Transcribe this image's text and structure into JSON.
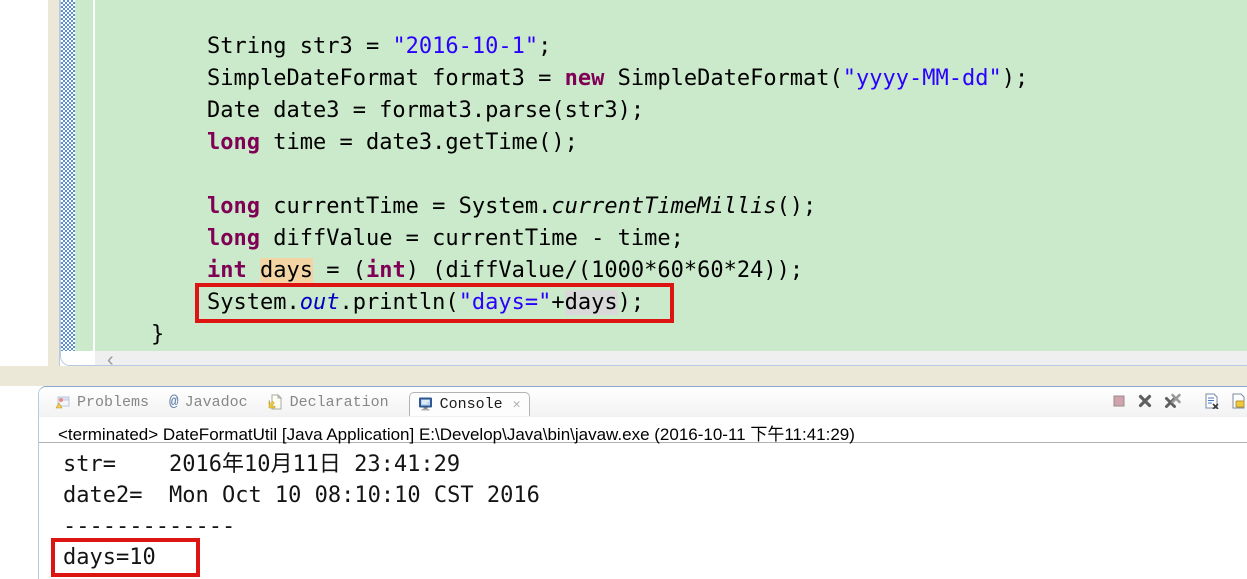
{
  "editor": {
    "lines": [
      {
        "indent": 2,
        "tokens": [
          {
            "t": "String str3 = ",
            "c": "p"
          },
          {
            "t": "\"2016-10-1\"",
            "c": "s"
          },
          {
            "t": ";",
            "c": "p"
          }
        ]
      },
      {
        "indent": 2,
        "tokens": [
          {
            "t": "SimpleDateFormat format3 = ",
            "c": "p"
          },
          {
            "t": "new",
            "c": "k"
          },
          {
            "t": " SimpleDateFormat(",
            "c": "p"
          },
          {
            "t": "\"yyyy-MM-dd\"",
            "c": "s"
          },
          {
            "t": ");",
            "c": "p"
          }
        ]
      },
      {
        "indent": 2,
        "tokens": [
          {
            "t": "Date date3 = format3.parse(str3);",
            "c": "p"
          }
        ]
      },
      {
        "indent": 2,
        "tokens": [
          {
            "t": "long",
            "c": "k"
          },
          {
            "t": " time = date3.getTime();",
            "c": "p"
          }
        ]
      },
      {
        "indent": 2,
        "tokens": []
      },
      {
        "indent": 2,
        "tokens": [
          {
            "t": "long",
            "c": "k"
          },
          {
            "t": " currentTime = System.",
            "c": "p"
          },
          {
            "t": "currentTimeMillis",
            "c": "sm"
          },
          {
            "t": "();",
            "c": "p"
          }
        ]
      },
      {
        "indent": 2,
        "tokens": [
          {
            "t": "long",
            "c": "k"
          },
          {
            "t": " diffValue = currentTime - time;",
            "c": "p"
          }
        ]
      },
      {
        "indent": 2,
        "tokens": [
          {
            "t": "int",
            "c": "k"
          },
          {
            "t": " ",
            "c": "p"
          },
          {
            "t": "days",
            "c": "w"
          },
          {
            "t": " = (",
            "c": "p"
          },
          {
            "t": "int",
            "c": "k"
          },
          {
            "t": ") (diffValue/(1000*60*60*24));",
            "c": "p"
          }
        ]
      },
      {
        "indent": 2,
        "boxed": true,
        "tokens": [
          {
            "t": "System.",
            "c": "p"
          },
          {
            "t": "out",
            "c": "sf"
          },
          {
            "t": ".println(",
            "c": "p"
          },
          {
            "t": "\"days=\"",
            "c": "s"
          },
          {
            "t": "+",
            "c": "p"
          },
          {
            "t": "days",
            "c": "r"
          },
          {
            "t": ");",
            "c": "p"
          }
        ]
      },
      {
        "indent": 1,
        "tokens": [
          {
            "t": "}",
            "c": "p"
          }
        ]
      }
    ],
    "scroll_left_glyph": "‹"
  },
  "console": {
    "tabs": [
      {
        "label": "Problems",
        "icon": "problems-icon",
        "active": false
      },
      {
        "label": "Javadoc",
        "icon": "javadoc-icon",
        "active": false
      },
      {
        "label": "Declaration",
        "icon": "declaration-icon",
        "active": false
      },
      {
        "label": "Console",
        "icon": "console-icon",
        "active": true,
        "closable": true
      }
    ],
    "close_glyph": "✕",
    "toolbar": [
      {
        "name": "terminate-button",
        "icon": "terminate-icon"
      },
      {
        "name": "remove-launch-button",
        "icon": "remove-launch-icon"
      },
      {
        "name": "remove-all-terminated-button",
        "icon": "remove-all-icon"
      },
      {
        "name": "separator",
        "icon": "separator"
      },
      {
        "name": "clear-console-button",
        "icon": "clear-console-icon"
      },
      {
        "name": "scroll-lock-button",
        "icon": "scroll-lock-icon"
      }
    ],
    "status_line": "<terminated> DateFormatUtil [Java Application] E:\\Develop\\Java\\bin\\javaw.exe (2016-10-11 下午11:41:29)",
    "output_lines": [
      {
        "text": "str=\t2016年10月11日 23:41:29",
        "boxed": false
      },
      {
        "text": "date2=\tMon Oct 10 08:10:10 CST 2016",
        "boxed": false
      },
      {
        "text": "-------------",
        "boxed": false
      },
      {
        "text": "days=10",
        "boxed": true
      }
    ]
  },
  "colors": {
    "editor_background": "#cbe9cb",
    "keyword": "#7f0055",
    "string": "#2a00ff",
    "static_field": "#0000c0",
    "annotation_box_red": "#dc1512",
    "occurrence_write": "#f3d5a5",
    "occurrence_read": "#d9d9d9",
    "gutter_checker_blue": "#5b8ed6",
    "chrome_beige": "#ebe8d8"
  }
}
